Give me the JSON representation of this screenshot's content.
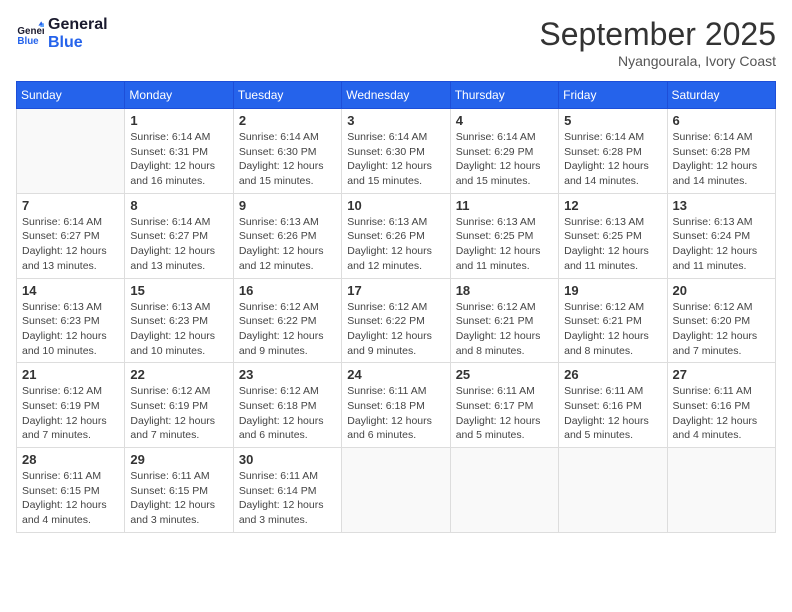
{
  "logo": {
    "line1": "General",
    "line2": "Blue"
  },
  "title": "September 2025",
  "location": "Nyangourala, Ivory Coast",
  "days_header": [
    "Sunday",
    "Monday",
    "Tuesday",
    "Wednesday",
    "Thursday",
    "Friday",
    "Saturday"
  ],
  "weeks": [
    [
      {
        "day": "",
        "info": ""
      },
      {
        "day": "1",
        "info": "Sunrise: 6:14 AM\nSunset: 6:31 PM\nDaylight: 12 hours\nand 16 minutes."
      },
      {
        "day": "2",
        "info": "Sunrise: 6:14 AM\nSunset: 6:30 PM\nDaylight: 12 hours\nand 15 minutes."
      },
      {
        "day": "3",
        "info": "Sunrise: 6:14 AM\nSunset: 6:30 PM\nDaylight: 12 hours\nand 15 minutes."
      },
      {
        "day": "4",
        "info": "Sunrise: 6:14 AM\nSunset: 6:29 PM\nDaylight: 12 hours\nand 15 minutes."
      },
      {
        "day": "5",
        "info": "Sunrise: 6:14 AM\nSunset: 6:28 PM\nDaylight: 12 hours\nand 14 minutes."
      },
      {
        "day": "6",
        "info": "Sunrise: 6:14 AM\nSunset: 6:28 PM\nDaylight: 12 hours\nand 14 minutes."
      }
    ],
    [
      {
        "day": "7",
        "info": "Sunrise: 6:14 AM\nSunset: 6:27 PM\nDaylight: 12 hours\nand 13 minutes."
      },
      {
        "day": "8",
        "info": "Sunrise: 6:14 AM\nSunset: 6:27 PM\nDaylight: 12 hours\nand 13 minutes."
      },
      {
        "day": "9",
        "info": "Sunrise: 6:13 AM\nSunset: 6:26 PM\nDaylight: 12 hours\nand 12 minutes."
      },
      {
        "day": "10",
        "info": "Sunrise: 6:13 AM\nSunset: 6:26 PM\nDaylight: 12 hours\nand 12 minutes."
      },
      {
        "day": "11",
        "info": "Sunrise: 6:13 AM\nSunset: 6:25 PM\nDaylight: 12 hours\nand 11 minutes."
      },
      {
        "day": "12",
        "info": "Sunrise: 6:13 AM\nSunset: 6:25 PM\nDaylight: 12 hours\nand 11 minutes."
      },
      {
        "day": "13",
        "info": "Sunrise: 6:13 AM\nSunset: 6:24 PM\nDaylight: 12 hours\nand 11 minutes."
      }
    ],
    [
      {
        "day": "14",
        "info": "Sunrise: 6:13 AM\nSunset: 6:23 PM\nDaylight: 12 hours\nand 10 minutes."
      },
      {
        "day": "15",
        "info": "Sunrise: 6:13 AM\nSunset: 6:23 PM\nDaylight: 12 hours\nand 10 minutes."
      },
      {
        "day": "16",
        "info": "Sunrise: 6:12 AM\nSunset: 6:22 PM\nDaylight: 12 hours\nand 9 minutes."
      },
      {
        "day": "17",
        "info": "Sunrise: 6:12 AM\nSunset: 6:22 PM\nDaylight: 12 hours\nand 9 minutes."
      },
      {
        "day": "18",
        "info": "Sunrise: 6:12 AM\nSunset: 6:21 PM\nDaylight: 12 hours\nand 8 minutes."
      },
      {
        "day": "19",
        "info": "Sunrise: 6:12 AM\nSunset: 6:21 PM\nDaylight: 12 hours\nand 8 minutes."
      },
      {
        "day": "20",
        "info": "Sunrise: 6:12 AM\nSunset: 6:20 PM\nDaylight: 12 hours\nand 7 minutes."
      }
    ],
    [
      {
        "day": "21",
        "info": "Sunrise: 6:12 AM\nSunset: 6:19 PM\nDaylight: 12 hours\nand 7 minutes."
      },
      {
        "day": "22",
        "info": "Sunrise: 6:12 AM\nSunset: 6:19 PM\nDaylight: 12 hours\nand 7 minutes."
      },
      {
        "day": "23",
        "info": "Sunrise: 6:12 AM\nSunset: 6:18 PM\nDaylight: 12 hours\nand 6 minutes."
      },
      {
        "day": "24",
        "info": "Sunrise: 6:11 AM\nSunset: 6:18 PM\nDaylight: 12 hours\nand 6 minutes."
      },
      {
        "day": "25",
        "info": "Sunrise: 6:11 AM\nSunset: 6:17 PM\nDaylight: 12 hours\nand 5 minutes."
      },
      {
        "day": "26",
        "info": "Sunrise: 6:11 AM\nSunset: 6:16 PM\nDaylight: 12 hours\nand 5 minutes."
      },
      {
        "day": "27",
        "info": "Sunrise: 6:11 AM\nSunset: 6:16 PM\nDaylight: 12 hours\nand 4 minutes."
      }
    ],
    [
      {
        "day": "28",
        "info": "Sunrise: 6:11 AM\nSunset: 6:15 PM\nDaylight: 12 hours\nand 4 minutes."
      },
      {
        "day": "29",
        "info": "Sunrise: 6:11 AM\nSunset: 6:15 PM\nDaylight: 12 hours\nand 3 minutes."
      },
      {
        "day": "30",
        "info": "Sunrise: 6:11 AM\nSunset: 6:14 PM\nDaylight: 12 hours\nand 3 minutes."
      },
      {
        "day": "",
        "info": ""
      },
      {
        "day": "",
        "info": ""
      },
      {
        "day": "",
        "info": ""
      },
      {
        "day": "",
        "info": ""
      }
    ]
  ]
}
